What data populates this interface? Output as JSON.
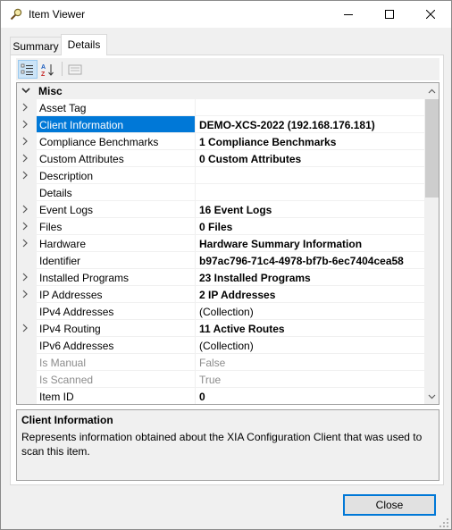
{
  "window": {
    "title": "Item Viewer"
  },
  "tabs": [
    {
      "label": "Summary",
      "active": false
    },
    {
      "label": "Details",
      "active": true
    }
  ],
  "toolbar": {
    "categorized_icon": "categorized-icon",
    "alphabetical_icon": "alphabetical-icon",
    "property_pages_icon": "property-pages-icon"
  },
  "grid": {
    "category": "Misc",
    "rows": [
      {
        "name": "Asset Tag",
        "value": "",
        "expandable": true,
        "style": "normal"
      },
      {
        "name": "Client Information",
        "value": "DEMO-XCS-2022 (192.168.176.181)",
        "expandable": true,
        "style": "bold",
        "selected": true
      },
      {
        "name": "Compliance Benchmarks",
        "value": "1 Compliance Benchmarks",
        "expandable": true,
        "style": "bold"
      },
      {
        "name": "Custom Attributes",
        "value": "0 Custom Attributes",
        "expandable": true,
        "style": "bold"
      },
      {
        "name": "Description",
        "value": "",
        "expandable": true,
        "style": "normal"
      },
      {
        "name": "Details",
        "value": "",
        "expandable": false,
        "style": "normal"
      },
      {
        "name": "Event Logs",
        "value": "16 Event Logs",
        "expandable": true,
        "style": "bold"
      },
      {
        "name": "Files",
        "value": "0 Files",
        "expandable": true,
        "style": "bold"
      },
      {
        "name": "Hardware",
        "value": "Hardware Summary Information",
        "expandable": true,
        "style": "bold"
      },
      {
        "name": "Identifier",
        "value": "b97ac796-71c4-4978-bf7b-6ec7404cea58",
        "expandable": false,
        "style": "bold"
      },
      {
        "name": "Installed Programs",
        "value": "23 Installed Programs",
        "expandable": true,
        "style": "bold"
      },
      {
        "name": "IP Addresses",
        "value": "2 IP Addresses",
        "expandable": true,
        "style": "bold"
      },
      {
        "name": "IPv4 Addresses",
        "value": "(Collection)",
        "expandable": false,
        "style": "normal"
      },
      {
        "name": "IPv4 Routing",
        "value": "11 Active Routes",
        "expandable": true,
        "style": "bold"
      },
      {
        "name": "IPv6 Addresses",
        "value": "(Collection)",
        "expandable": false,
        "style": "normal"
      },
      {
        "name": "Is Manual",
        "value": "False",
        "expandable": false,
        "style": "readonly"
      },
      {
        "name": "Is Scanned",
        "value": "True",
        "expandable": false,
        "style": "readonly"
      },
      {
        "name": "Item ID",
        "value": "0",
        "expandable": false,
        "style": "bold"
      }
    ]
  },
  "description": {
    "title": "Client Information",
    "text": "Represents information obtained about the XIA Configuration Client that was used to scan this item."
  },
  "buttons": {
    "close": "Close"
  },
  "colors": {
    "selection": "#0078d7",
    "accent_border": "#0078d7"
  }
}
